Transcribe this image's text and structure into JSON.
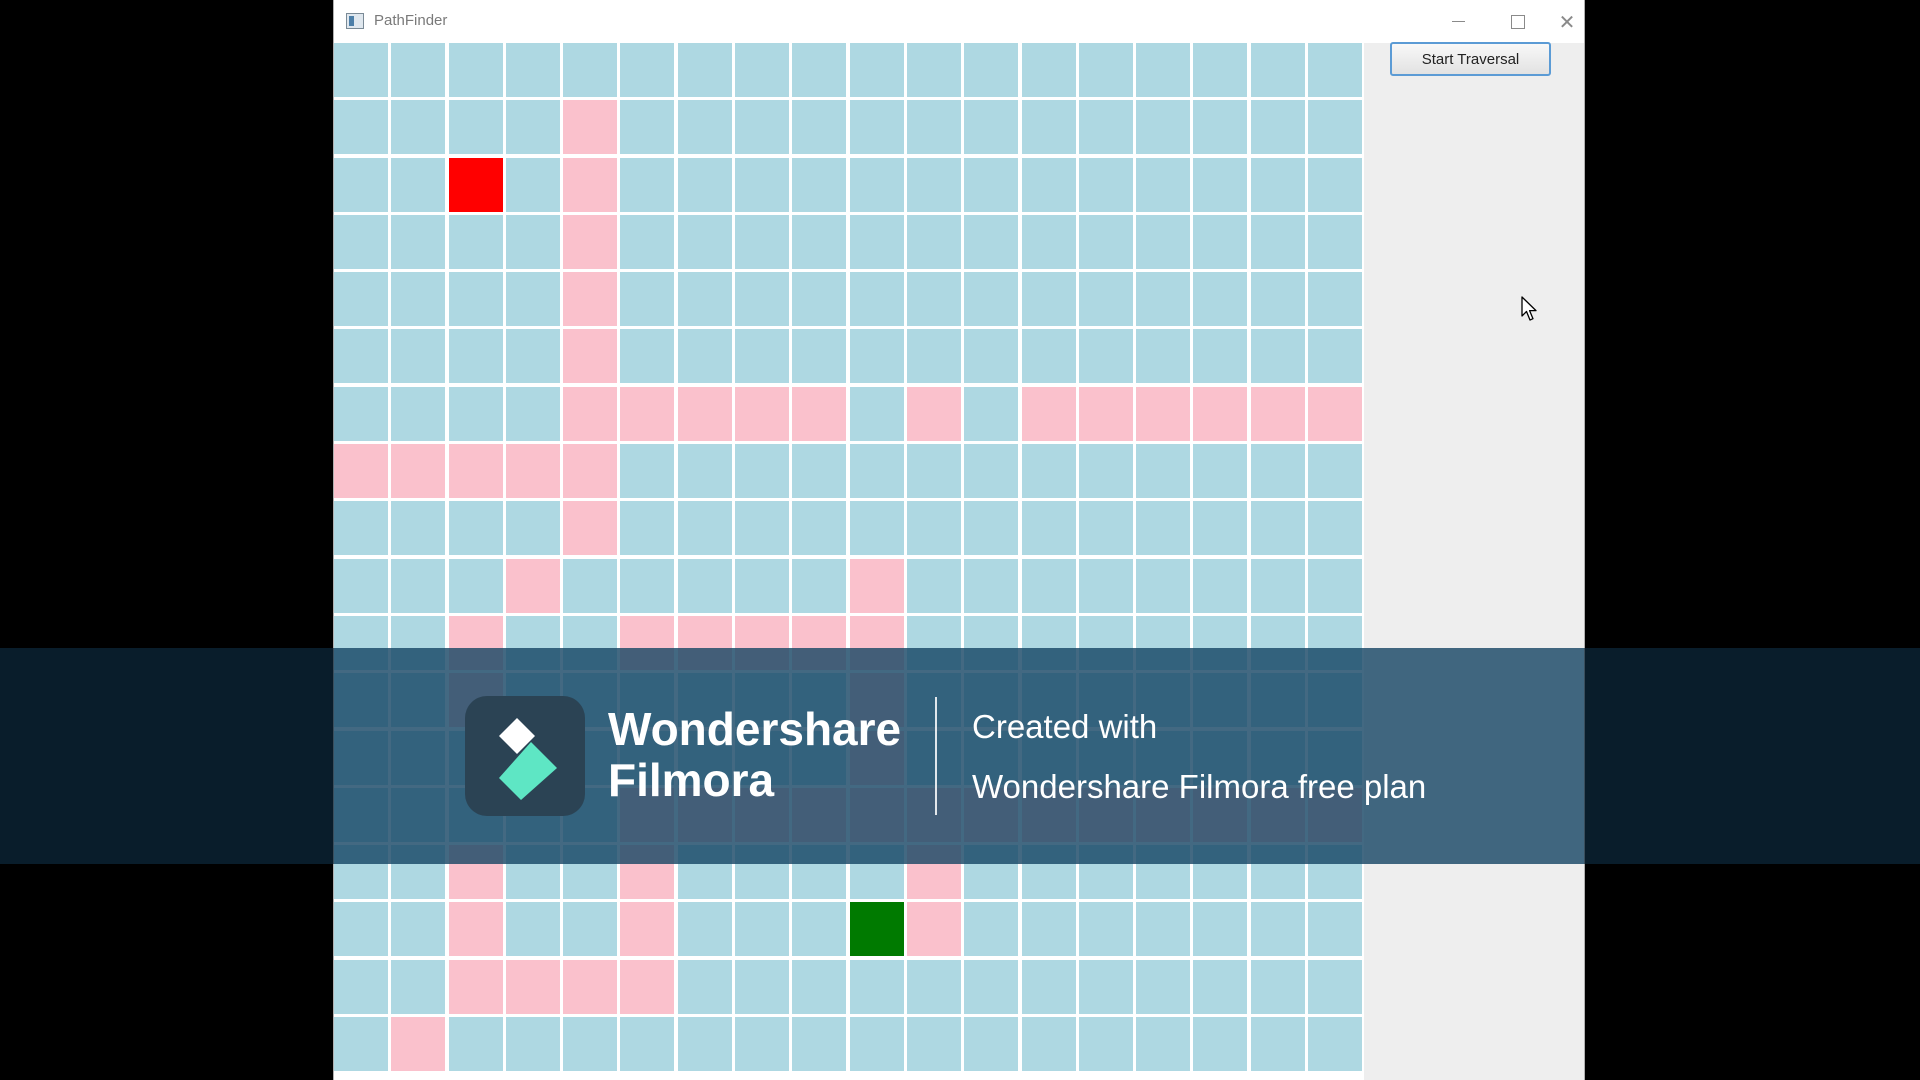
{
  "window": {
    "title": "PathFinder",
    "minimize_icon": "minimize-icon",
    "maximize_icon": "maximize-icon",
    "close_glyph": "✕"
  },
  "toolbar": {
    "start_label": "Start Traversal"
  },
  "grid": {
    "columns": 18,
    "rows": 18,
    "colors": {
      "empty": "#aed8e2",
      "wall": "#fac1cc",
      "start": "#ff0000",
      "goal": "#007a00",
      "grid_line": "#ffffff"
    },
    "rows_data": [
      "..................",
      "....W.............",
      "..S.W.............",
      "....W.............",
      "....W.............",
      "....W.............",
      "....WWWWW.W.WWWWWW",
      "WWWWW.............",
      "....W.............",
      "...W.....W........",
      "..W..WWWWW........",
      "..W......W........",
      ".........W........",
      ".....WWWWWWWWWWWWW",
      "..W..W....W.......",
      "..W..W...GW.......",
      "..WWWW............",
      ".W................"
    ]
  },
  "watermark": {
    "brand_line_1": "Wondershare",
    "brand_line_2": "Filmora",
    "created_with": "Created with",
    "plan_text": "Wondershare Filmora free plan",
    "logo_icon": "filmora-logo-icon"
  }
}
